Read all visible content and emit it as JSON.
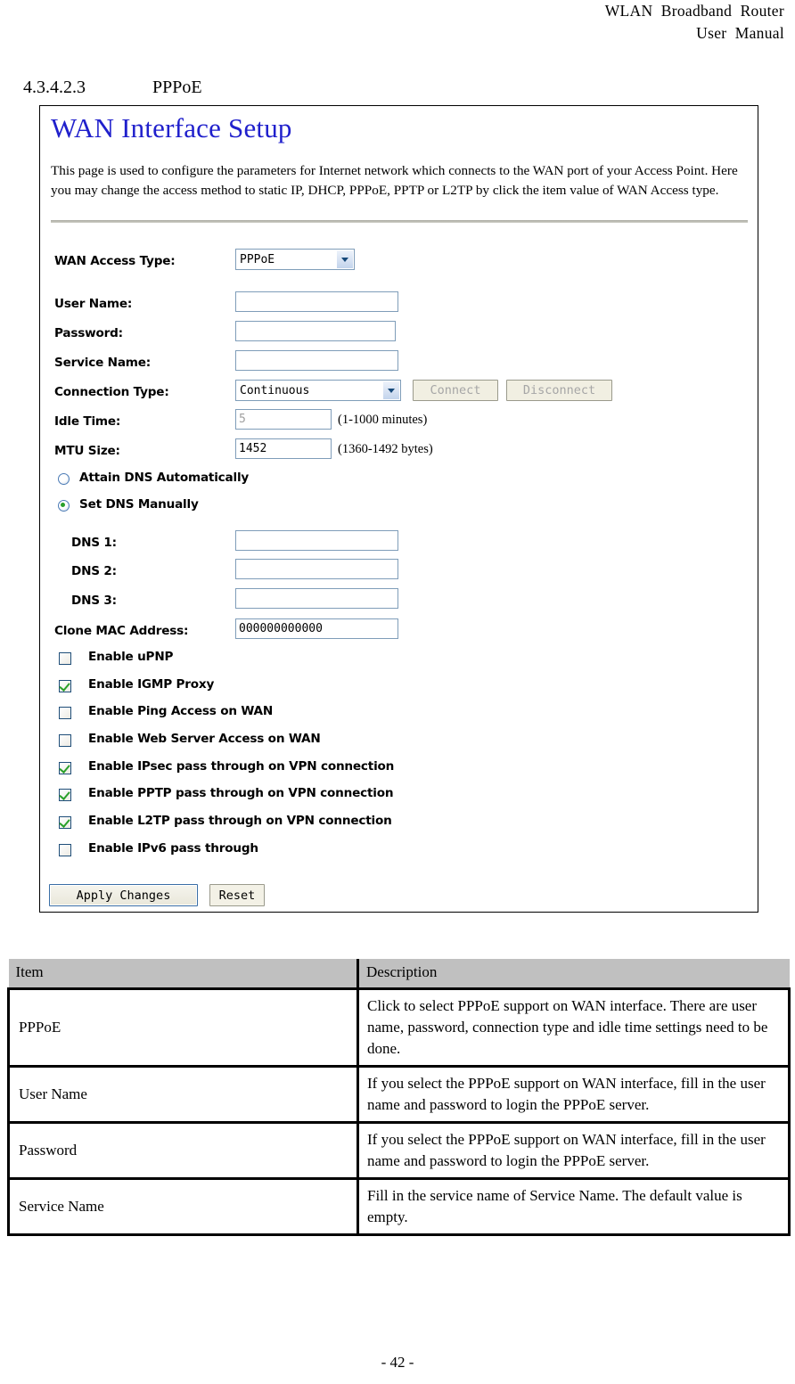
{
  "header": {
    "line1": "WLAN  Broadband  Router",
    "line2": "User  Manual"
  },
  "section": {
    "number": "4.3.4.2.3",
    "title": "PPPoE"
  },
  "ui_panel": {
    "title": "WAN Interface Setup",
    "description": "This page is used to configure the parameters for Internet network which connects to the WAN port of your Access Point. Here you may change the access method to static IP, DHCP, PPPoE, PPTP or L2TP by click the item value of WAN Access type.",
    "fields": {
      "wan_access_type_label": "WAN Access Type:",
      "wan_access_type_value": "PPPoE",
      "user_name_label": "User Name:",
      "user_name_value": "",
      "password_label": "Password:",
      "password_value": "",
      "service_name_label": "Service Name:",
      "service_name_value": "",
      "connection_type_label": "Connection Type:",
      "connection_type_value": "Continuous",
      "connect_button": "Connect",
      "disconnect_button": "Disconnect",
      "idle_time_label": "Idle Time:",
      "idle_time_value": "5",
      "idle_time_hint": "(1-1000 minutes)",
      "mtu_size_label": "MTU Size:",
      "mtu_size_value": "1452",
      "mtu_size_hint": "(1360-1492 bytes)",
      "dns1_label": "DNS 1:",
      "dns1_value": "",
      "dns2_label": "DNS 2:",
      "dns2_value": "",
      "dns3_label": "DNS 3:",
      "dns3_value": "",
      "clone_mac_label": "Clone MAC Address:",
      "clone_mac_value": "000000000000"
    },
    "dns_radios": [
      {
        "label": "Attain DNS Automatically",
        "selected": false
      },
      {
        "label": "Set DNS Manually",
        "selected": true
      }
    ],
    "checkboxes": [
      {
        "label": "Enable uPNP",
        "checked": false
      },
      {
        "label": "Enable IGMP Proxy",
        "checked": true
      },
      {
        "label": "Enable Ping Access on WAN",
        "checked": false
      },
      {
        "label": "Enable Web Server Access on WAN",
        "checked": false
      },
      {
        "label": "Enable IPsec pass through on VPN connection",
        "checked": true
      },
      {
        "label": "Enable PPTP pass through on VPN connection",
        "checked": true
      },
      {
        "label": "Enable L2TP pass through on VPN connection",
        "checked": true
      },
      {
        "label": "Enable IPv6 pass through",
        "checked": false
      }
    ],
    "buttons": {
      "apply_changes": "Apply Changes",
      "reset": "Reset"
    },
    "colors": {
      "title_blue": "#2020cc",
      "input_border": "#7f9db9",
      "check_green": "#2aa02a",
      "checkbox_border": "#1f4e79"
    }
  },
  "table": {
    "headers": [
      "Item",
      "Description"
    ],
    "rows": [
      {
        "item": "PPPoE",
        "description": "Click to select PPPoE support on WAN interface. There are user name, password, connection type and idle time settings need to be done."
      },
      {
        "item": "User Name",
        "description": "If you select the PPPoE support on WAN interface, fill in the user name and password to login the PPPoE server."
      },
      {
        "item": "Password",
        "description": "If you select the PPPoE support on WAN interface, fill in the user name and password to login the PPPoE server."
      },
      {
        "item": "Service Name",
        "description": "Fill in the service name of Service Name. The default value is empty."
      }
    ]
  },
  "footer": {
    "page_number": "- 42 -"
  }
}
